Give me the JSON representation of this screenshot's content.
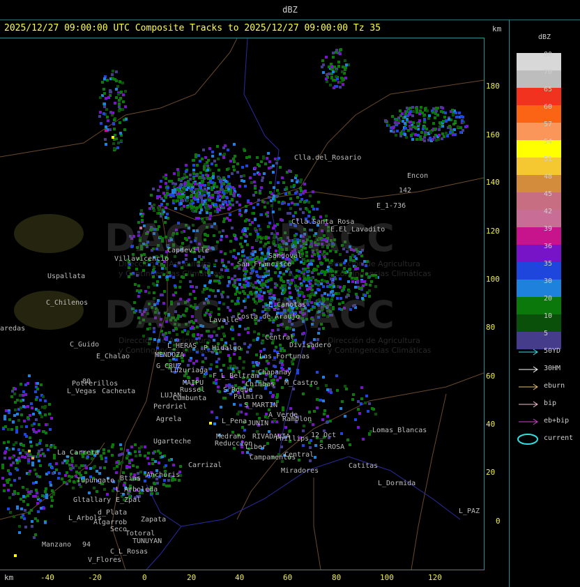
{
  "title": "dBZ",
  "header": "2025/12/27 09:00:00 UTC Composite Tracks to 2025/12/27 09:00:00 Tz 35",
  "axis_unit": "km",
  "y_ticks": [
    "180",
    "160",
    "140",
    "120",
    "100",
    "80",
    "60",
    "40",
    "20",
    "0"
  ],
  "x_ticks": [
    "-40",
    "-20",
    "0",
    "20",
    "40",
    "60",
    "80",
    "100",
    "120"
  ],
  "legend": {
    "title": "dBZ",
    "scale": [
      {
        "label": "80",
        "color": "#d8d8d8"
      },
      {
        "label": "70",
        "color": "#bdbdbd"
      },
      {
        "label": "65",
        "color": "#f0321e"
      },
      {
        "label": "60",
        "color": "#fa6414"
      },
      {
        "label": "57",
        "color": "#fa965a"
      },
      {
        "label": "54",
        "color": "#ffff00"
      },
      {
        "label": "51",
        "color": "#f5c832"
      },
      {
        "label": "48",
        "color": "#d28c3c"
      },
      {
        "label": "45",
        "color": "#c86e82"
      },
      {
        "label": "42",
        "color": "#c86e96"
      },
      {
        "label": "39",
        "color": "#c8148c"
      },
      {
        "label": "36",
        "color": "#7814c8"
      },
      {
        "label": "35",
        "color": "#1e46dc"
      },
      {
        "label": "30",
        "color": "#1e82dc"
      },
      {
        "label": "20",
        "color": "#0a780a"
      },
      {
        "label": "10",
        "color": "#0a500a"
      },
      {
        "label": "5",
        "color": "#463c8c"
      }
    ],
    "tracks": [
      {
        "label": "50YD",
        "color": "#40e0e0"
      },
      {
        "label": "30HM",
        "color": "#ffffff"
      },
      {
        "label": "eburn",
        "color": "#e8c070"
      },
      {
        "label": "bip",
        "color": "#f0c0d0"
      },
      {
        "label": "eb+bip",
        "color": "#d040d0"
      },
      {
        "label": "current",
        "color": "#30e0e0"
      }
    ]
  },
  "watermark": {
    "brand": "DACC",
    "line1": "Dirección de Agricultura",
    "line2": "y Contingencias Climáticas"
  },
  "cities": [
    {
      "name": "Clla.del_Rosario"
    },
    {
      "name": "Encon"
    },
    {
      "name": "E_1-736"
    },
    {
      "name": "142"
    },
    {
      "name": "Clla.Santa_Rosa"
    },
    {
      "name": "E.El_Lavadito"
    },
    {
      "name": "Villavicencio"
    },
    {
      "name": "Uspallata"
    },
    {
      "name": "Capdeville"
    },
    {
      "name": "San_Francisco"
    },
    {
      "name": "Sandoval"
    },
    {
      "name": "C_Chilenos"
    },
    {
      "name": "E_Canotas"
    },
    {
      "name": "C_Guido"
    },
    {
      "name": "L_HERAS"
    },
    {
      "name": "E_Chalao"
    },
    {
      "name": "MENDOZA"
    },
    {
      "name": "G_CRUZ"
    },
    {
      "name": "Luzuriaga"
    },
    {
      "name": "Lavalle"
    },
    {
      "name": "Costa_de_Araujo"
    },
    {
      "name": "P_Hidalgo"
    },
    {
      "name": "Central"
    },
    {
      "name": "Divisadero"
    },
    {
      "name": "Las_Fortunas"
    },
    {
      "name": "Potrerillos"
    },
    {
      "name": "Cacheuta"
    },
    {
      "name": "L_Vegas"
    },
    {
      "name": "MAIPU"
    },
    {
      "name": "Russel"
    },
    {
      "name": "F_L_Beltran"
    },
    {
      "name": "Chapanay"
    },
    {
      "name": "M_Castro"
    },
    {
      "name": "Chimbas"
    },
    {
      "name": "S_Roque"
    },
    {
      "name": "LUJAN"
    },
    {
      "name": "Cumbunta"
    },
    {
      "name": "Perdriel"
    },
    {
      "name": "S_MARTIN"
    },
    {
      "name": "Palmira"
    },
    {
      "name": "Agrela"
    },
    {
      "name": "A_Verde"
    },
    {
      "name": "Ramblon"
    },
    {
      "name": "JUNIN"
    },
    {
      "name": "L_Pena"
    },
    {
      "name": "RIVADAVIA"
    },
    {
      "name": "Phillips"
    },
    {
      "name": "12_Oct"
    },
    {
      "name": "Lomas_Blancas"
    },
    {
      "name": "Ugarteche"
    },
    {
      "name": "Reduccion"
    },
    {
      "name": "Medrano"
    },
    {
      "name": "S.ROSA"
    },
    {
      "name": "Liber"
    },
    {
      "name": "Campamentos"
    },
    {
      "name": "Central"
    },
    {
      "name": "Catitas"
    },
    {
      "name": "La_Carrera"
    },
    {
      "name": "Tupungato"
    },
    {
      "name": "Carrizal"
    },
    {
      "name": "Anchoris"
    },
    {
      "name": "Btias"
    },
    {
      "name": "L_Arboleda"
    },
    {
      "name": "Miradores"
    },
    {
      "name": "L_Dormida"
    },
    {
      "name": "Gltallary"
    },
    {
      "name": "E_Zpal"
    },
    {
      "name": "d_Plata"
    },
    {
      "name": "L_Arbols"
    },
    {
      "name": "Algarrob"
    },
    {
      "name": "Zapata"
    },
    {
      "name": "Seco"
    },
    {
      "name": "Totoral"
    },
    {
      "name": "TUNUYAN"
    },
    {
      "name": "Manzano"
    },
    {
      "name": "C_L_Rosas"
    },
    {
      "name": "V_Flores"
    },
    {
      "name": "L_PAZ"
    },
    {
      "name": "aredas"
    },
    {
      "name": "80"
    },
    {
      "name": "94"
    }
  ]
}
